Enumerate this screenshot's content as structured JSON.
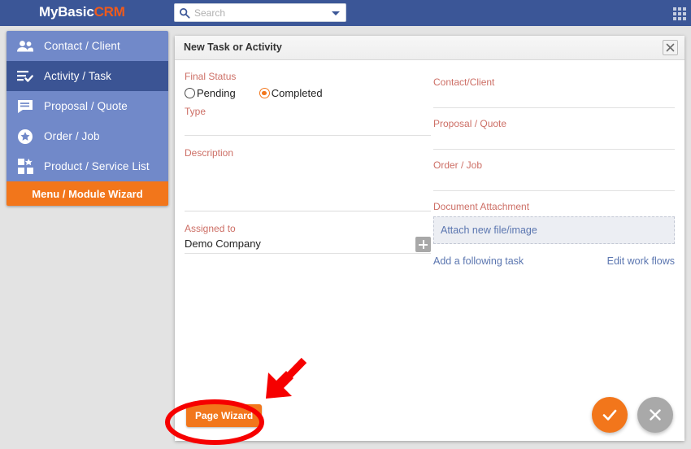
{
  "topbar": {
    "brand_primary": "MyBasic",
    "brand_accent": "CRM",
    "search_placeholder": "Search",
    "search_value": "",
    "apps_icon": "grid-apps-icon",
    "background": "#3b5697",
    "accent": "#ef5a1c"
  },
  "sidebar": {
    "items": [
      {
        "label": "Contact / Client",
        "icon": "people-icon",
        "active": false
      },
      {
        "label": "Activity / Task",
        "icon": "list-check-icon",
        "active": true
      },
      {
        "label": "Proposal / Quote",
        "icon": "speech-bubble-icon",
        "active": false
      },
      {
        "label": "Order / Job",
        "icon": "star-circle-icon",
        "active": false
      },
      {
        "label": "Product / Service List",
        "icon": "products-grid-icon",
        "active": false
      }
    ],
    "wizard_label": "Menu / Module Wizard",
    "item_color": "#7189c9",
    "active_color": "#3b5494",
    "wizard_color": "#f2761b"
  },
  "panel": {
    "title": "New Task or Activity",
    "close_icon": "close-icon",
    "label_color": "#cd6f66",
    "left_column": {
      "final_status": {
        "label": "Final Status",
        "options": [
          "Pending",
          "Completed"
        ],
        "selected": "Completed"
      },
      "type": {
        "label": "Type",
        "value": ""
      },
      "description": {
        "label": "Description",
        "value": ""
      },
      "assigned_to": {
        "label": "Assigned to",
        "value": "Demo Company",
        "add_icon": "plus-icon"
      }
    },
    "right_column": {
      "contact_client": {
        "label": "Contact/Client",
        "value": ""
      },
      "proposal_quote": {
        "label": "Proposal / Quote",
        "value": ""
      },
      "order_job": {
        "label": "Order / Job",
        "value": ""
      },
      "document_attachment": {
        "label": "Document Attachment",
        "attach_label": "Attach new file/image"
      },
      "links": {
        "add_following_task": "Add a following task",
        "edit_work_flows": "Edit work flows"
      }
    },
    "footer": {
      "page_wizard_label": "Page Wizard",
      "confirm_icon": "check-icon",
      "cancel_icon": "close-x-icon",
      "confirm_color": "#f2761b",
      "cancel_color": "#a9a9a9"
    }
  },
  "annotations": {
    "highlight_color": "#f60000",
    "highlight_target": "Page Wizard",
    "arrow_icon": "arrow-pointing-down-left-icon"
  }
}
